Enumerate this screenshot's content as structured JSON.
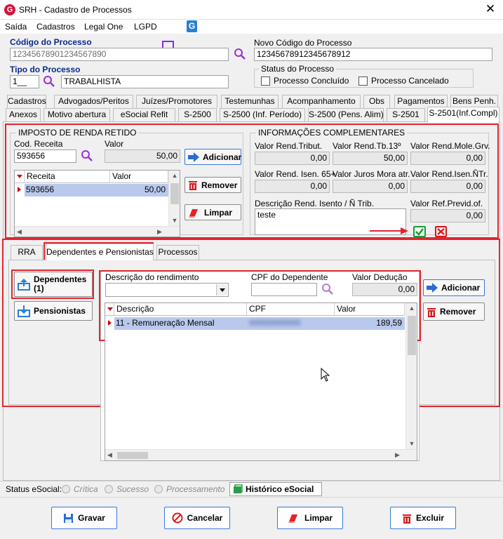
{
  "window": {
    "title": "SRH - Cadastro de Processos",
    "logo_letter": "G",
    "close": "✕"
  },
  "menu": {
    "items": [
      "Saída",
      "Cadastros",
      "Legal One",
      "LGPD"
    ]
  },
  "header": {
    "codigo_label": "Código do Processo",
    "codigo_value": "12345678901234567890",
    "novo_codigo_label": "Novo Código do Processo",
    "novo_codigo_value": "12345678912345678912",
    "tipo_label": "Tipo do Processo",
    "tipo_code": "1__",
    "tipo_value": "TRABALHISTA",
    "status_title": "Status do Processo",
    "status_concluido": "Processo Concluído",
    "status_cancelado": "Processo Cancelado"
  },
  "tabs_row1": [
    "Cadastros",
    "Advogados/Peritos",
    "Juízes/Promotores",
    "Testemunhas",
    "Acompanhamento",
    "Obs",
    "Pagamentos",
    "Bens Penh."
  ],
  "tabs_row2": [
    "Anexos",
    "Motivo abertura",
    "eSocial Refit",
    "S-2500",
    "S-2500 (Inf. Período)",
    "S-2500 (Pens. Alim)",
    "S-2501",
    "S-2501(Inf.Compl)"
  ],
  "ir": {
    "title": "IMPOSTO DE RENDA RETIDO",
    "cod_receita_label": "Cod. Receita",
    "cod_receita_value": "593656",
    "valor_label": "Valor",
    "valor_value": "50,00",
    "btn_adicionar": "Adicionar",
    "btn_remover": "Remover",
    "btn_limpar": "Limpar",
    "grid_headers": [
      "Receita",
      "Valor"
    ],
    "grid_rows": [
      {
        "receita": "593656",
        "valor": "50,00"
      }
    ]
  },
  "info": {
    "title": "INFORMAÇÕES COMPLEMENTARES",
    "fields": [
      {
        "label": "Valor Rend.Tribut.",
        "value": "0,00"
      },
      {
        "label": "Valor Rend.Tb.13º",
        "value": "50,00"
      },
      {
        "label": "Valor Rend.Mole.Grv.",
        "value": "0,00"
      },
      {
        "label": "Valor Rend. Isen. 65+",
        "value": "0,00"
      },
      {
        "label": "Valor Juros Mora atr.",
        "value": "0,00"
      },
      {
        "label": "Valor Rend.Isen.ÑTr.",
        "value": "0,00"
      }
    ],
    "descricao_label": "Descrição Rend. Isento / Ñ Trib.",
    "descricao_value": "teste",
    "ref_previd_label": "Valor Ref.Previd.of.",
    "ref_previd_value": "0,00"
  },
  "subtabs": [
    "RRA",
    "Dependentes e Pensionistas",
    "Processos"
  ],
  "dep": {
    "btn_dependentes": "Dependentes",
    "btn_dependentes_count": "(1)",
    "btn_pensionistas": "Pensionistas",
    "descricao_label": "Descrição do rendimento",
    "descricao_value": "",
    "cpf_label": "CPF do Dependente",
    "cpf_value": "",
    "valor_label": "Valor Dedução",
    "valor_value": "0,00",
    "btn_adicionar": "Adicionar",
    "btn_remover": "Remover",
    "grid_headers": [
      "Descrição",
      "CPF",
      "Valor"
    ],
    "grid_rows": [
      {
        "descricao": "11 - Remuneração Mensal",
        "cpf": "00000000000",
        "valor": "189,59"
      }
    ]
  },
  "statusbar": {
    "label": "Status eSocial:",
    "options": [
      "Crítica",
      "Sucesso",
      "Processamento"
    ],
    "historico": "Histórico eSocial"
  },
  "footer": {
    "gravar": "Gravar",
    "cancelar": "Cancelar",
    "limpar": "Limpar",
    "excluir": "Excluir"
  },
  "colors": {
    "accent_blue": "#3a78d8",
    "highlight_red": "#e0262e",
    "row_selected": "#b9c9ee",
    "lgpd_purple": "#8a2be2",
    "search_purple": "#9b30d9"
  }
}
